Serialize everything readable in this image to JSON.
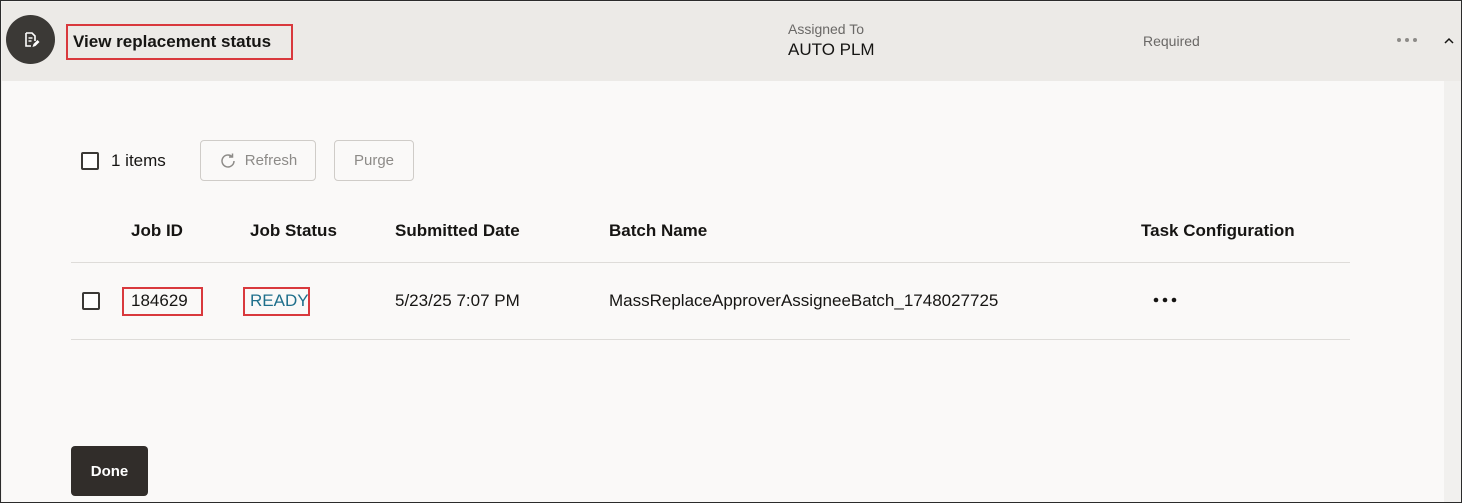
{
  "header": {
    "task_icon": "task-edit-icon",
    "title": "View replacement status",
    "assigned_to_label": "Assigned To",
    "assigned_to_value": "AUTO PLM",
    "required_label": "Required",
    "more_icon": "more-horizontal-icon",
    "collapse_icon": "chevron-up-icon"
  },
  "toolbar": {
    "count_label": "1 items",
    "refresh_label": "Refresh",
    "refresh_icon": "refresh-icon",
    "purge_label": "Purge"
  },
  "table": {
    "columns": [
      "Job ID",
      "Job Status",
      "Submitted Date",
      "Batch Name",
      "Task Configuration"
    ],
    "rows": [
      {
        "job_id": "184629",
        "job_status": "READY",
        "submitted_date": "5/23/25 7:07 PM",
        "batch_name": "MassReplaceApproverAssigneeBatch_1748027725",
        "task_configuration_icon": "more-horizontal-icon"
      }
    ]
  },
  "footer": {
    "done_label": "Done"
  },
  "colors": {
    "highlight_border": "#d9393d",
    "link": "#1f6f8b",
    "primary_button": "#312d2a"
  }
}
